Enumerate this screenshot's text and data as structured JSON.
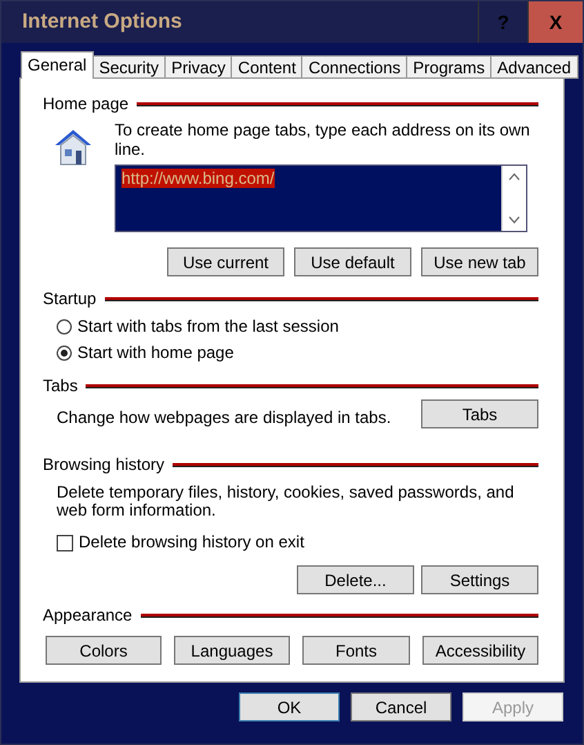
{
  "window": {
    "title": "Internet Options",
    "help": "?",
    "close": "X"
  },
  "tabs": [
    {
      "label": "General",
      "selected": true
    },
    {
      "label": "Security",
      "selected": false
    },
    {
      "label": "Privacy",
      "selected": false
    },
    {
      "label": "Content",
      "selected": false
    },
    {
      "label": "Connections",
      "selected": false
    },
    {
      "label": "Programs",
      "selected": false
    },
    {
      "label": "Advanced",
      "selected": false
    }
  ],
  "home_page": {
    "heading": "Home page",
    "hint": "To create home page tabs, type each address on its own line.",
    "value": "http://www.bing.com/",
    "buttons": [
      "Use current",
      "Use default",
      "Use new tab"
    ]
  },
  "startup": {
    "heading": "Startup",
    "options": [
      {
        "label": "Start with tabs from the last session",
        "selected": false
      },
      {
        "label": "Start with home page",
        "selected": true
      }
    ]
  },
  "tabs_section": {
    "heading": "Tabs",
    "text": "Change how webpages are displayed in tabs.",
    "button": "Tabs"
  },
  "browsing_history": {
    "heading": "Browsing history",
    "text": "Delete temporary files, history, cookies, saved passwords, and web form information.",
    "checkbox": {
      "label": "Delete browsing history on exit",
      "checked": false
    },
    "buttons": [
      "Delete...",
      "Settings"
    ]
  },
  "appearance": {
    "heading": "Appearance",
    "buttons": [
      "Colors",
      "Languages",
      "Fonts",
      "Accessibility"
    ]
  },
  "footer_buttons": [
    {
      "label": "OK",
      "disabled": false,
      "default": true
    },
    {
      "label": "Cancel",
      "disabled": false,
      "default": false
    },
    {
      "label": "Apply",
      "disabled": true,
      "default": false
    }
  ]
}
